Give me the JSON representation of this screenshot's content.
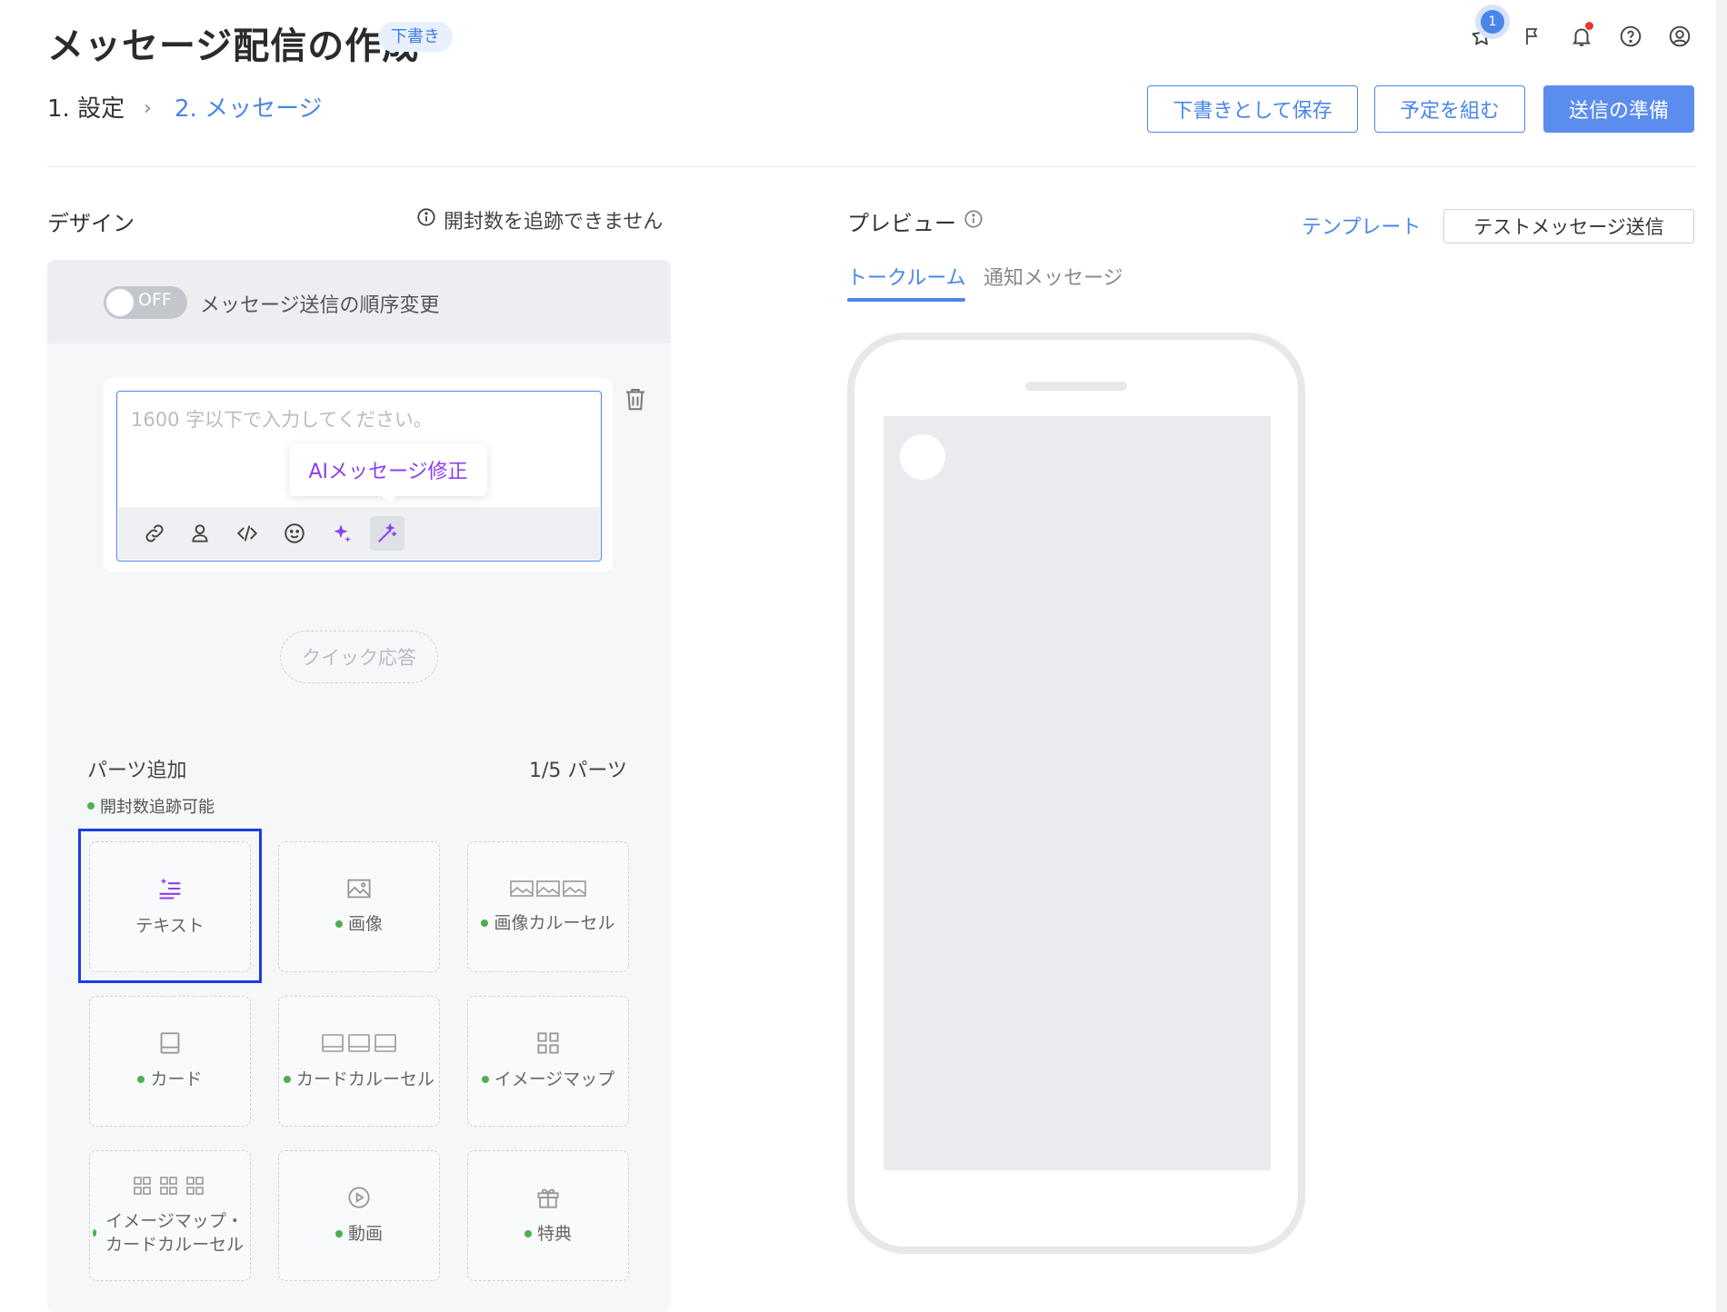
{
  "header": {
    "title": "メッセージ配信の作成",
    "status_badge": "下書き",
    "notification_count": "1"
  },
  "steps": {
    "step1": "1. 設定",
    "separator": "›",
    "step2": "2. メッセージ"
  },
  "actions": {
    "save_draft": "下書きとして保存",
    "schedule": "予定を組む",
    "prepare_send": "送信の準備"
  },
  "design": {
    "title": "デザイン",
    "open_tracking_note": "開封数を追跡できません",
    "toggle_state": "OFF",
    "toggle_label": "メッセージ送信の順序変更",
    "editor_placeholder": "1600 字以下で入力してください。",
    "ai_tooltip": "AIメッセージ修正",
    "quick_reply": "クイック応答",
    "parts_title": "パーツ追加",
    "parts_count": "1/5 パーツ",
    "trackable_label": "開封数追跡可能",
    "parts": [
      {
        "label": "テキスト",
        "icon": "text-icon",
        "trackable": false
      },
      {
        "label": "画像",
        "icon": "image-icon",
        "trackable": true
      },
      {
        "label": "画像カルーセル",
        "icon": "image-carousel-icon",
        "trackable": true
      },
      {
        "label": "カード",
        "icon": "card-icon",
        "trackable": true
      },
      {
        "label": "カードカルーセル",
        "icon": "card-carousel-icon",
        "trackable": true
      },
      {
        "label": "イメージマップ",
        "icon": "imagemap-icon",
        "trackable": true
      },
      {
        "label": "イメージマップ・カードカルーセル",
        "icon": "imagemap-card-carousel-icon",
        "trackable": true
      },
      {
        "label": "動画",
        "icon": "video-icon",
        "trackable": true
      },
      {
        "label": "特典",
        "icon": "gift-icon",
        "trackable": true
      }
    ]
  },
  "preview": {
    "title": "プレビュー",
    "template_link": "テンプレート",
    "test_send": "テストメッセージ送信",
    "tabs": [
      "トークルーム",
      "通知メッセージ"
    ]
  },
  "colors": {
    "accent": "#4a86e8",
    "ai_purple": "#8a3ff0",
    "trackable_green": "#4caf50",
    "selection_outline": "#1b3de0"
  }
}
